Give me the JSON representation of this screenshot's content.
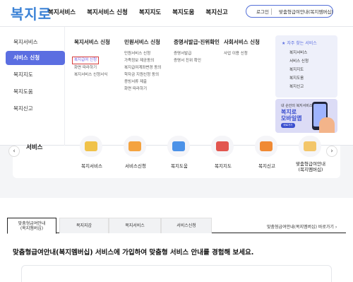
{
  "header": {
    "logo": "복지로",
    "nav": [
      "복지서비스",
      "복지서비스 신청",
      "복지지도",
      "복지도움",
      "복지신고"
    ],
    "login_label": "로그인",
    "custom_info_label": "맞춤형급여안내(복지멤버십)"
  },
  "sidebar": {
    "items": [
      {
        "label": "복지서비스"
      },
      {
        "label": "서비스 신청"
      },
      {
        "label": "복지지도"
      },
      {
        "label": "복지도움"
      },
      {
        "label": "복지신고"
      }
    ]
  },
  "menu_columns": [
    {
      "head": "복지서비스 신청",
      "items": [
        "복지급여 신청",
        "화면 따라하기",
        "복지서비스 신청서식"
      ]
    },
    {
      "head": "민원서비스 신청",
      "items": [
        "민원서비스 신청",
        "가족정보 제공동의",
        "복지급여계좌변경 동의",
        "학자금 지원신청 동의",
        "증빙서류 제출",
        "화면 따라하기"
      ]
    },
    {
      "head": "증명서발급·진위확인",
      "items": [
        "증명서발급",
        "증명서 진위 확인"
      ]
    },
    {
      "head": "사회서비스 신청",
      "items": [
        "사업 이용 신청"
      ]
    }
  ],
  "favorites": {
    "title": "자주 찾는 서비스",
    "items": [
      "복지서비스",
      "서비스 신청",
      "복지지도",
      "복지도움",
      "복지신고"
    ]
  },
  "banner": {
    "line1": "내 손안의 복지서비스",
    "line2": "복지로",
    "line3": "모바일앱",
    "button": "바로가기"
  },
  "services": {
    "title": "서비스",
    "prev": "‹",
    "next": "›",
    "items": [
      {
        "label": "복지서비스",
        "color": "#f0c24a"
      },
      {
        "label": "서비스신청",
        "color": "#f4a340"
      },
      {
        "label": "복지도움",
        "color": "#4c92e8"
      },
      {
        "label": "복지지도",
        "color": "#e2564f"
      },
      {
        "label": "복지신고",
        "color": "#f08a34"
      },
      {
        "label": "맞춤형급여안내\n(복지멤버십)",
        "color": "#f3c66a"
      }
    ]
  },
  "tabs": {
    "items": [
      "맞춤형급여안내\n(복지멤버십)",
      "복지지갑",
      "복지서비스",
      "서비스신청"
    ],
    "more": "맞춤형급여안내(복지멤버십) 바로가기 ›"
  },
  "description": "맞춤형급여안내(복지멤버십) 서비스에 가입하여 맞춤형 서비스 안내를 경험해 보세요."
}
